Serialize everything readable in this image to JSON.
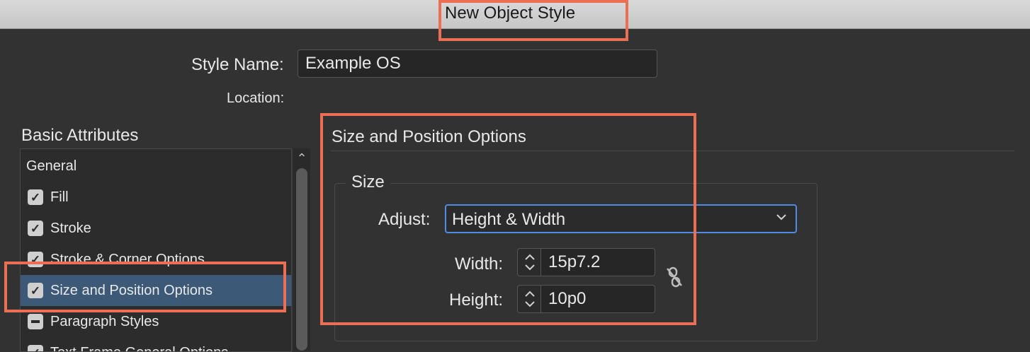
{
  "window": {
    "title": "New Object Style"
  },
  "style_name": {
    "label": "Style Name:",
    "value": "Example OS"
  },
  "location": {
    "label": "Location:"
  },
  "sidebar": {
    "heading": "Basic Attributes",
    "items": [
      {
        "label": "General",
        "check": "none"
      },
      {
        "label": "Fill",
        "check": "checked"
      },
      {
        "label": "Stroke",
        "check": "checked"
      },
      {
        "label": "Stroke & Corner Options",
        "check": "checked"
      },
      {
        "label": "Size and Position Options",
        "check": "checked",
        "selected": true
      },
      {
        "label": "Paragraph Styles",
        "check": "mixed"
      },
      {
        "label": "Text Frame General Options",
        "check": "checked"
      }
    ]
  },
  "panel": {
    "title": "Size and Position Options",
    "size_group": {
      "legend": "Size",
      "adjust": {
        "label": "Adjust:",
        "value": "Height & Width"
      },
      "width": {
        "label": "Width:",
        "value": "15p7.2"
      },
      "height": {
        "label": "Height:",
        "value": "10p0"
      }
    }
  },
  "icons": {
    "chevron": "chevron-down-icon",
    "stepper": "up-down-arrows-icon",
    "constrain": "broken-chain-link-icon"
  },
  "colors": {
    "highlight": "#ec6f55",
    "selection": "#3c5a78",
    "focus": "#4f8de0"
  }
}
